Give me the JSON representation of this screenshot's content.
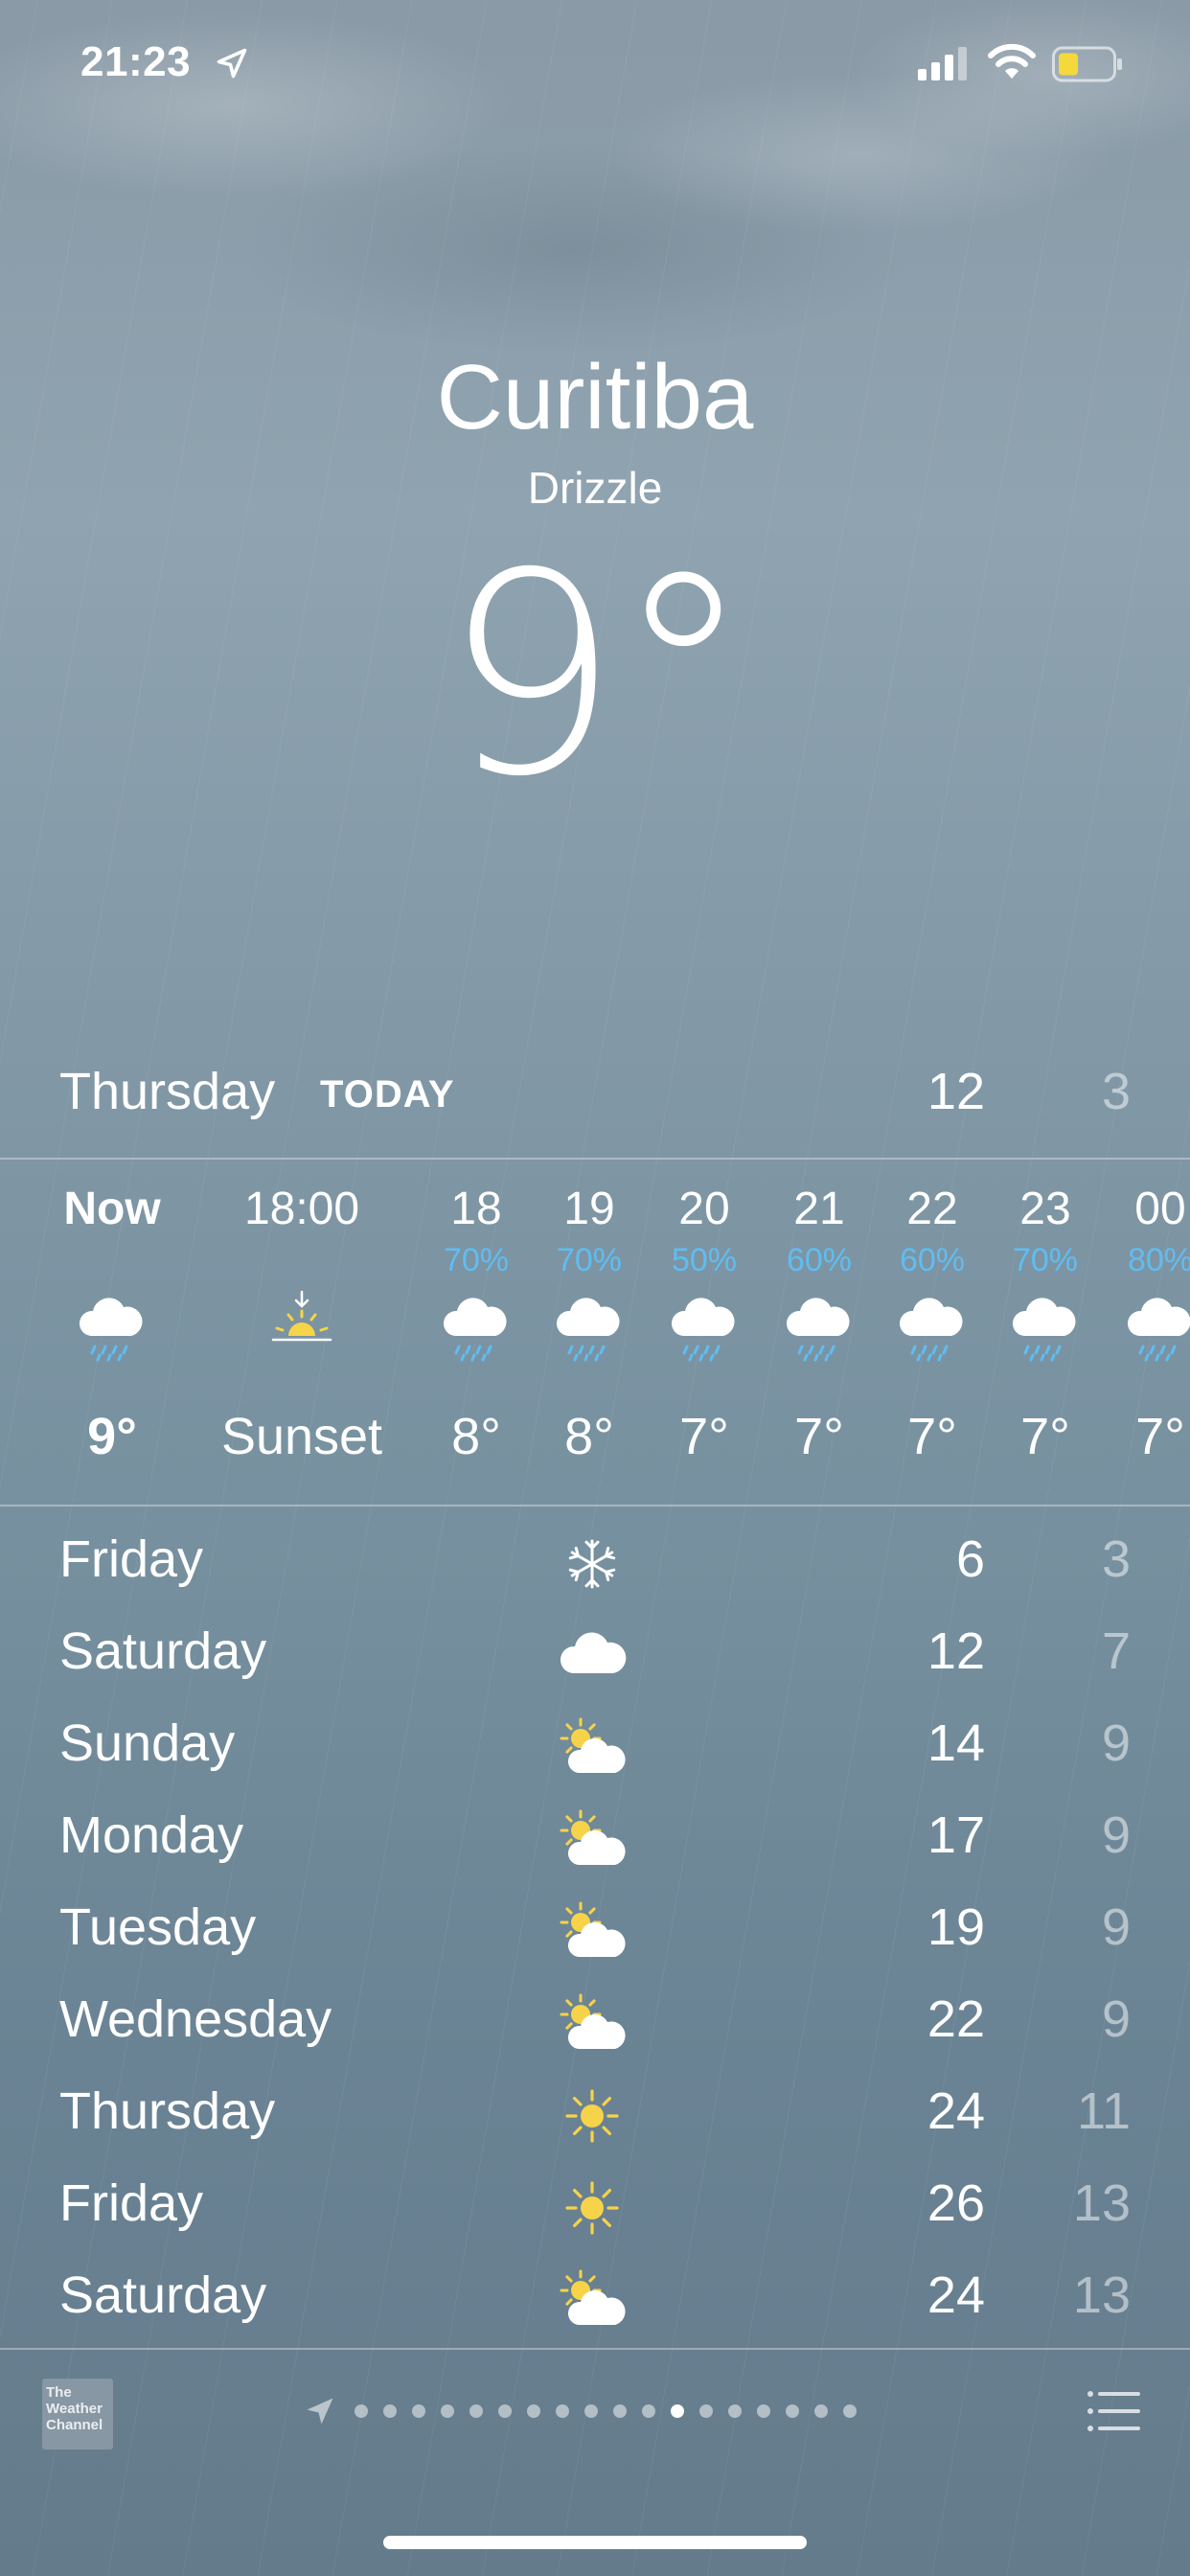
{
  "status_bar": {
    "time": "21:23"
  },
  "header": {
    "city": "Curitiba",
    "condition": "Drizzle",
    "temperature": "9°"
  },
  "today": {
    "day": "Thursday",
    "tag": "TODAY",
    "high": "12",
    "low": "3"
  },
  "hourly": [
    {
      "label": "Now",
      "pct": "",
      "icon": "rain-cloud-icon",
      "temp": "9°"
    },
    {
      "label": "18:00",
      "pct": "",
      "icon": "sunset-icon",
      "temp": "Sunset"
    },
    {
      "label": "18",
      "pct": "70%",
      "icon": "rain-cloud-icon",
      "temp": "8°"
    },
    {
      "label": "19",
      "pct": "70%",
      "icon": "rain-cloud-icon",
      "temp": "8°"
    },
    {
      "label": "20",
      "pct": "50%",
      "icon": "rain-cloud-icon",
      "temp": "7°"
    },
    {
      "label": "21",
      "pct": "60%",
      "icon": "rain-cloud-icon",
      "temp": "7°"
    },
    {
      "label": "22",
      "pct": "60%",
      "icon": "rain-cloud-icon",
      "temp": "7°"
    },
    {
      "label": "23",
      "pct": "70%",
      "icon": "rain-cloud-icon",
      "temp": "7°"
    },
    {
      "label": "00",
      "pct": "80%",
      "icon": "rain-cloud-icon",
      "temp": "7°"
    }
  ],
  "daily": [
    {
      "day": "Friday",
      "icon": "snowflake-icon",
      "high": "6",
      "low": "3"
    },
    {
      "day": "Saturday",
      "icon": "cloud-icon",
      "high": "12",
      "low": "7"
    },
    {
      "day": "Sunday",
      "icon": "partly-cloudy-icon",
      "high": "14",
      "low": "9"
    },
    {
      "day": "Monday",
      "icon": "partly-cloudy-icon",
      "high": "17",
      "low": "9"
    },
    {
      "day": "Tuesday",
      "icon": "partly-cloudy-icon",
      "high": "19",
      "low": "9"
    },
    {
      "day": "Wednesday",
      "icon": "partly-cloudy-icon",
      "high": "22",
      "low": "9"
    },
    {
      "day": "Thursday",
      "icon": "sun-icon",
      "high": "24",
      "low": "11"
    },
    {
      "day": "Friday",
      "icon": "sun-icon",
      "high": "26",
      "low": "13"
    },
    {
      "day": "Saturday",
      "icon": "partly-cloudy-icon",
      "high": "24",
      "low": "13"
    }
  ],
  "bottom_bar": {
    "logo_text": "The Weather Channel",
    "page_dots": 18,
    "active_page_dot": 11
  },
  "colors": {
    "precip_percent": "#5fbdf2",
    "sun": "#f7d34a",
    "battery": "#f4d83c"
  }
}
